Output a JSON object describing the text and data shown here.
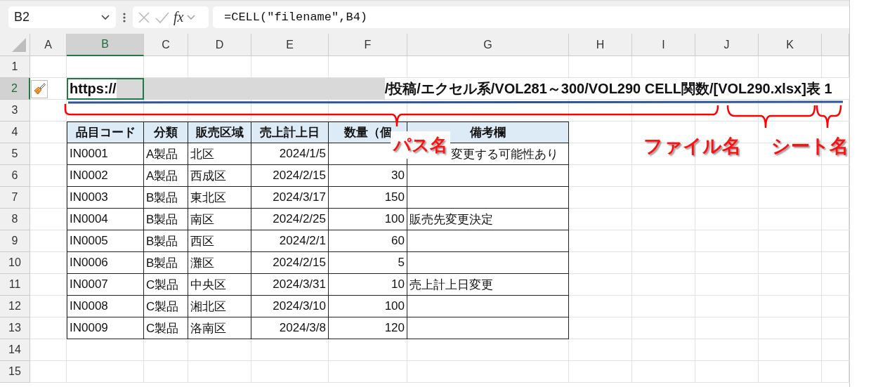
{
  "formula_bar": {
    "name_box": "B2",
    "function_label": "fx",
    "formula": "=CELL(\"filename\",B4)"
  },
  "sheet": {
    "columns": [
      {
        "label": "A",
        "selected": false
      },
      {
        "label": "B",
        "selected": true
      },
      {
        "label": "C",
        "selected": false
      },
      {
        "label": "D",
        "selected": false
      },
      {
        "label": "E",
        "selected": false
      },
      {
        "label": "F",
        "selected": false
      },
      {
        "label": "G",
        "selected": false
      },
      {
        "label": "H",
        "selected": false
      },
      {
        "label": "I",
        "selected": false
      },
      {
        "label": "J",
        "selected": false
      },
      {
        "label": "K",
        "selected": false
      }
    ],
    "rows": [
      {
        "label": "1",
        "selected": false
      },
      {
        "label": "2",
        "selected": true
      },
      {
        "label": "3",
        "selected": false
      },
      {
        "label": "4",
        "selected": false
      },
      {
        "label": "5",
        "selected": false
      },
      {
        "label": "6",
        "selected": false
      },
      {
        "label": "7",
        "selected": false
      },
      {
        "label": "8",
        "selected": false
      },
      {
        "label": "9",
        "selected": false
      },
      {
        "label": "10",
        "selected": false
      },
      {
        "label": "11",
        "selected": false
      },
      {
        "label": "12",
        "selected": false
      },
      {
        "label": "13",
        "selected": false
      },
      {
        "label": "14",
        "selected": false
      },
      {
        "label": "15",
        "selected": false
      }
    ]
  },
  "result_cell": {
    "prefix": "https://",
    "suffix": "/投稿/エクセル系/VOL281～300/VOL290 CELL関数/[VOL290.xlsx]表 1"
  },
  "table": {
    "columns": [
      {
        "label": "品目コード",
        "kind": "text"
      },
      {
        "label": "分類",
        "kind": "text"
      },
      {
        "label": "販売区域",
        "kind": "text"
      },
      {
        "label": "売上計上日",
        "kind": "date"
      },
      {
        "label": "数量（個",
        "kind": "number"
      },
      {
        "label": "備考欄",
        "kind": "text"
      }
    ],
    "rows": [
      [
        "IN0001",
        "A製品",
        "北区",
        "2024/1/5",
        null,
        "変更する可能性あり"
      ],
      [
        "IN0002",
        "A製品",
        "西成区",
        "2024/2/15",
        "30",
        null
      ],
      [
        "IN0003",
        "B製品",
        "東北区",
        "2024/3/17",
        "150",
        null
      ],
      [
        "IN0004",
        "B製品",
        "南区",
        "2024/2/25",
        "100",
        "販売先変更決定"
      ],
      [
        "IN0005",
        "B製品",
        "西区",
        "2024/2/1",
        "60",
        null
      ],
      [
        "IN0006",
        "B製品",
        "灘区",
        "2024/2/15",
        "5",
        null
      ],
      [
        "IN0007",
        "C製品",
        "中央区",
        "2024/3/31",
        "10",
        "売上計上日変更"
      ],
      [
        "IN0008",
        "C製品",
        "湘北区",
        "2024/3/10",
        "100",
        null
      ],
      [
        "IN0009",
        "C製品",
        "洛南区",
        "2024/3/8",
        "120",
        null
      ]
    ]
  },
  "annotations": [
    {
      "label": "パス名"
    },
    {
      "label": "ファイル名"
    },
    {
      "label": "シート名"
    }
  ]
}
